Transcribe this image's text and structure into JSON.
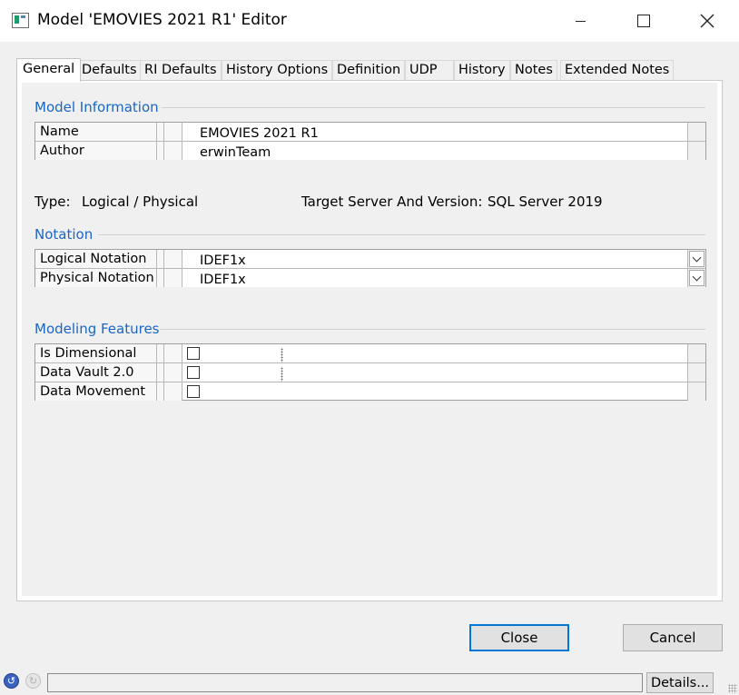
{
  "window": {
    "title": "Model 'EMOVIES 2021 R1' Editor",
    "minimize_icon": "minimize-icon",
    "maximize_icon": "maximize-icon",
    "close_icon": "close-icon"
  },
  "tabs": [
    {
      "label": "General",
      "active": true
    },
    {
      "label": "Defaults"
    },
    {
      "label": "RI Defaults"
    },
    {
      "label": "History Options"
    },
    {
      "label": "Definition"
    },
    {
      "label": "UDP"
    },
    {
      "label": "History"
    },
    {
      "label": "Notes"
    },
    {
      "label": "Extended Notes"
    }
  ],
  "model_information": {
    "title": "Model Information",
    "rows": [
      {
        "label": "Name",
        "value": "EMOVIES 2021 R1"
      },
      {
        "label": "Author",
        "value": "erwinTeam"
      }
    ]
  },
  "info": {
    "type_label": "Type:",
    "type_value": "Logical / Physical",
    "target_label": "Target Server And Version:",
    "target_value": "SQL Server 2019"
  },
  "notation": {
    "title": "Notation",
    "rows": [
      {
        "label": "Logical Notation",
        "value": "IDEF1x"
      },
      {
        "label": "Physical Notation",
        "value": "IDEF1x"
      }
    ]
  },
  "modeling_features": {
    "title": "Modeling Features",
    "rows": [
      {
        "label": "Is Dimensional",
        "checked": false
      },
      {
        "label": "Data Vault 2.0",
        "checked": false
      },
      {
        "label": "Data Movement",
        "checked": false
      }
    ]
  },
  "buttons": {
    "close": "Close",
    "cancel": "Cancel"
  },
  "statusbar": {
    "details": "Details..."
  },
  "colors": {
    "accent": "#1a66c2",
    "default_button_border": "#0078d7"
  }
}
